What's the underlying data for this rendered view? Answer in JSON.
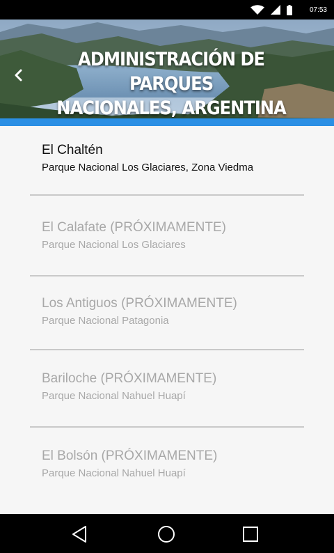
{
  "status_bar": {
    "time": "07:53",
    "icons": [
      "wifi-icon",
      "signal-icon",
      "battery-icon"
    ]
  },
  "header": {
    "title_line1": "ADMINISTRACIÓN DE PARQUES",
    "title_line2": "NACIONALES, ARGENTINA",
    "back_icon": "chevron-left-icon"
  },
  "colors": {
    "accent": "#2b8fe4",
    "background": "#f6f6f6",
    "active_text": "#111111",
    "disabled_text": "#a8a8a8",
    "divider": "#c9c9c9"
  },
  "locations": [
    {
      "title": "El Chaltén",
      "subtitle": "Parque Nacional Los Glaciares, Zona Viedma",
      "enabled": true
    },
    {
      "title": "El Calafate (PRÓXIMAMENTE)",
      "subtitle": "Parque Nacional Los Glaciares",
      "enabled": false
    },
    {
      "title": "Los Antiguos (PRÓXIMAMENTE)",
      "subtitle": "Parque Nacional Patagonia",
      "enabled": false
    },
    {
      "title": "Bariloche (PRÓXIMAMENTE)",
      "subtitle": "Parque Nacional Nahuel Huapí",
      "enabled": false
    },
    {
      "title": "El Bolsón (PRÓXIMAMENTE)",
      "subtitle": "Parque Nacional Nahuel Huapí",
      "enabled": false
    }
  ],
  "nav_bar": {
    "buttons": [
      "back-triangle-icon",
      "home-circle-icon",
      "recents-square-icon"
    ]
  }
}
